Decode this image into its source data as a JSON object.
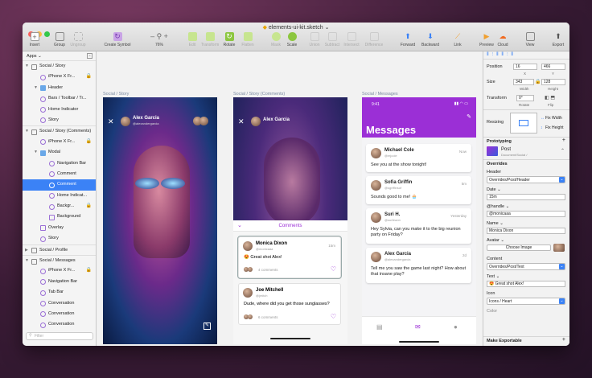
{
  "window": {
    "title": "elements-ui-kit.sketch",
    "title_suffix": "⌄"
  },
  "toolbar": {
    "insert": "Insert",
    "group": "Group",
    "ungroup": "Ungroup",
    "create_symbol": "Create Symbol",
    "zoom": "76%",
    "edit": "Edit",
    "transform": "Transform",
    "rotate": "Rotate",
    "flatten": "Flatten",
    "mask": "Mask",
    "scale": "Scale",
    "union": "Union",
    "subtract": "Subtract",
    "intersect": "Intersect",
    "difference": "Difference",
    "forward": "Forward",
    "backward": "Backward",
    "link": "Link",
    "preview": "Preview",
    "cloud": "Cloud",
    "view": "View",
    "export": "Export"
  },
  "sidebar": {
    "page": "Apps",
    "filter_placeholder": "Filter",
    "layers": [
      {
        "label": "Social / Story"
      },
      {
        "label": "iPhone X Fr..."
      },
      {
        "label": "Header"
      },
      {
        "label": "Bars / Toolbar / Tr..."
      },
      {
        "label": "Home Indicator"
      },
      {
        "label": "Story"
      },
      {
        "label": "Social / Story (Comments)"
      },
      {
        "label": "iPhone X Fr..."
      },
      {
        "label": "Modal"
      },
      {
        "label": "Navigation Bar"
      },
      {
        "label": "Comment"
      },
      {
        "label": "Comment"
      },
      {
        "label": "Home Indicat..."
      },
      {
        "label": "Backgr..."
      },
      {
        "label": "Background"
      },
      {
        "label": "Overlay"
      },
      {
        "label": "Story"
      },
      {
        "label": "Social / Profile"
      },
      {
        "label": "Social / Messages"
      },
      {
        "label": "iPhone X Fr..."
      },
      {
        "label": "Navigation Bar"
      },
      {
        "label": "Tab Bar"
      },
      {
        "label": "Conversation"
      },
      {
        "label": "Conversation"
      },
      {
        "label": "Conversation"
      }
    ]
  },
  "artboards": {
    "story": {
      "label": "Social / Story",
      "user": "Alex Garcia",
      "handle": "@alexandergarcia"
    },
    "comments": {
      "label": "Social / Story (Comments)",
      "user": "Alex Garcia",
      "title": "Comments",
      "items": [
        {
          "name": "Monica Dixon",
          "handle": "@monicaaa",
          "time": "15m",
          "text": "😍 Great shot Alex!",
          "count": "4 comments"
        },
        {
          "name": "Joe Mitchell",
          "handle": "@jmitch",
          "time": "",
          "text": "Dude, where did you get those sunglasses?",
          "count": "6 comments"
        }
      ]
    },
    "messages": {
      "label": "Social / Messages",
      "time": "9:41",
      "title": "Messages",
      "items": [
        {
          "name": "Michael Cole",
          "handle": "@mjcole",
          "time": "Now",
          "text": "See you at the show tonight!"
        },
        {
          "name": "Sofia Griffin",
          "handle": "@sgriffinsof",
          "time": "5m",
          "text": "Sounds good to me! 🧁"
        },
        {
          "name": "Suri H.",
          "handle": "@surikwon",
          "time": "Yesterday",
          "text": "Hey Sylvia, can you make it to the big reunion party on Friday?"
        },
        {
          "name": "Alex Garcia",
          "handle": "@alexandergarcia",
          "time": "2d",
          "text": "Tell me you saw the game last night? How about that insane play?"
        }
      ]
    }
  },
  "inspector": {
    "position": "Position",
    "x": "16",
    "y": "466",
    "x_lbl": "X",
    "y_lbl": "Y",
    "size": "Size",
    "w": "343",
    "h": "128",
    "w_lbl": "Width",
    "h_lbl": "Height",
    "transform": "Transform",
    "rotate_val": "0°",
    "rotate_lbl": "Rotate",
    "flip_lbl": "Flip",
    "resizing": "Resizing",
    "fix_width": "Fix Width",
    "fix_height": "Fix Height",
    "prototyping": "Prototyping",
    "symbol_name": "Post",
    "symbol_path": "Document/Social /",
    "overrides": "Overrides",
    "header_lbl": "Header",
    "header_val": "Overrides/Post/Header",
    "date_lbl": "Date ⌄",
    "date_val": "15m",
    "handle_lbl": "@handle ⌄",
    "handle_val": "@monicaaa",
    "name_lbl": "Name ⌄",
    "name_val": "Monica Dixon",
    "avatar_lbl": "Avatar ⌄",
    "choose_image": "Choose Image",
    "content_lbl": "Content",
    "content_val": "Overrides/Post/Text",
    "text_lbl": "Text ⌄",
    "text_val": "😍 Great shot Alex!",
    "icon_lbl": "Icon",
    "icon_val": "Icons / Heart",
    "color_lbl": "Color",
    "make_exportable": "Make Exportable"
  },
  "colors": {
    "accent": "#3b82f6",
    "purple": "#9b2fd6"
  }
}
